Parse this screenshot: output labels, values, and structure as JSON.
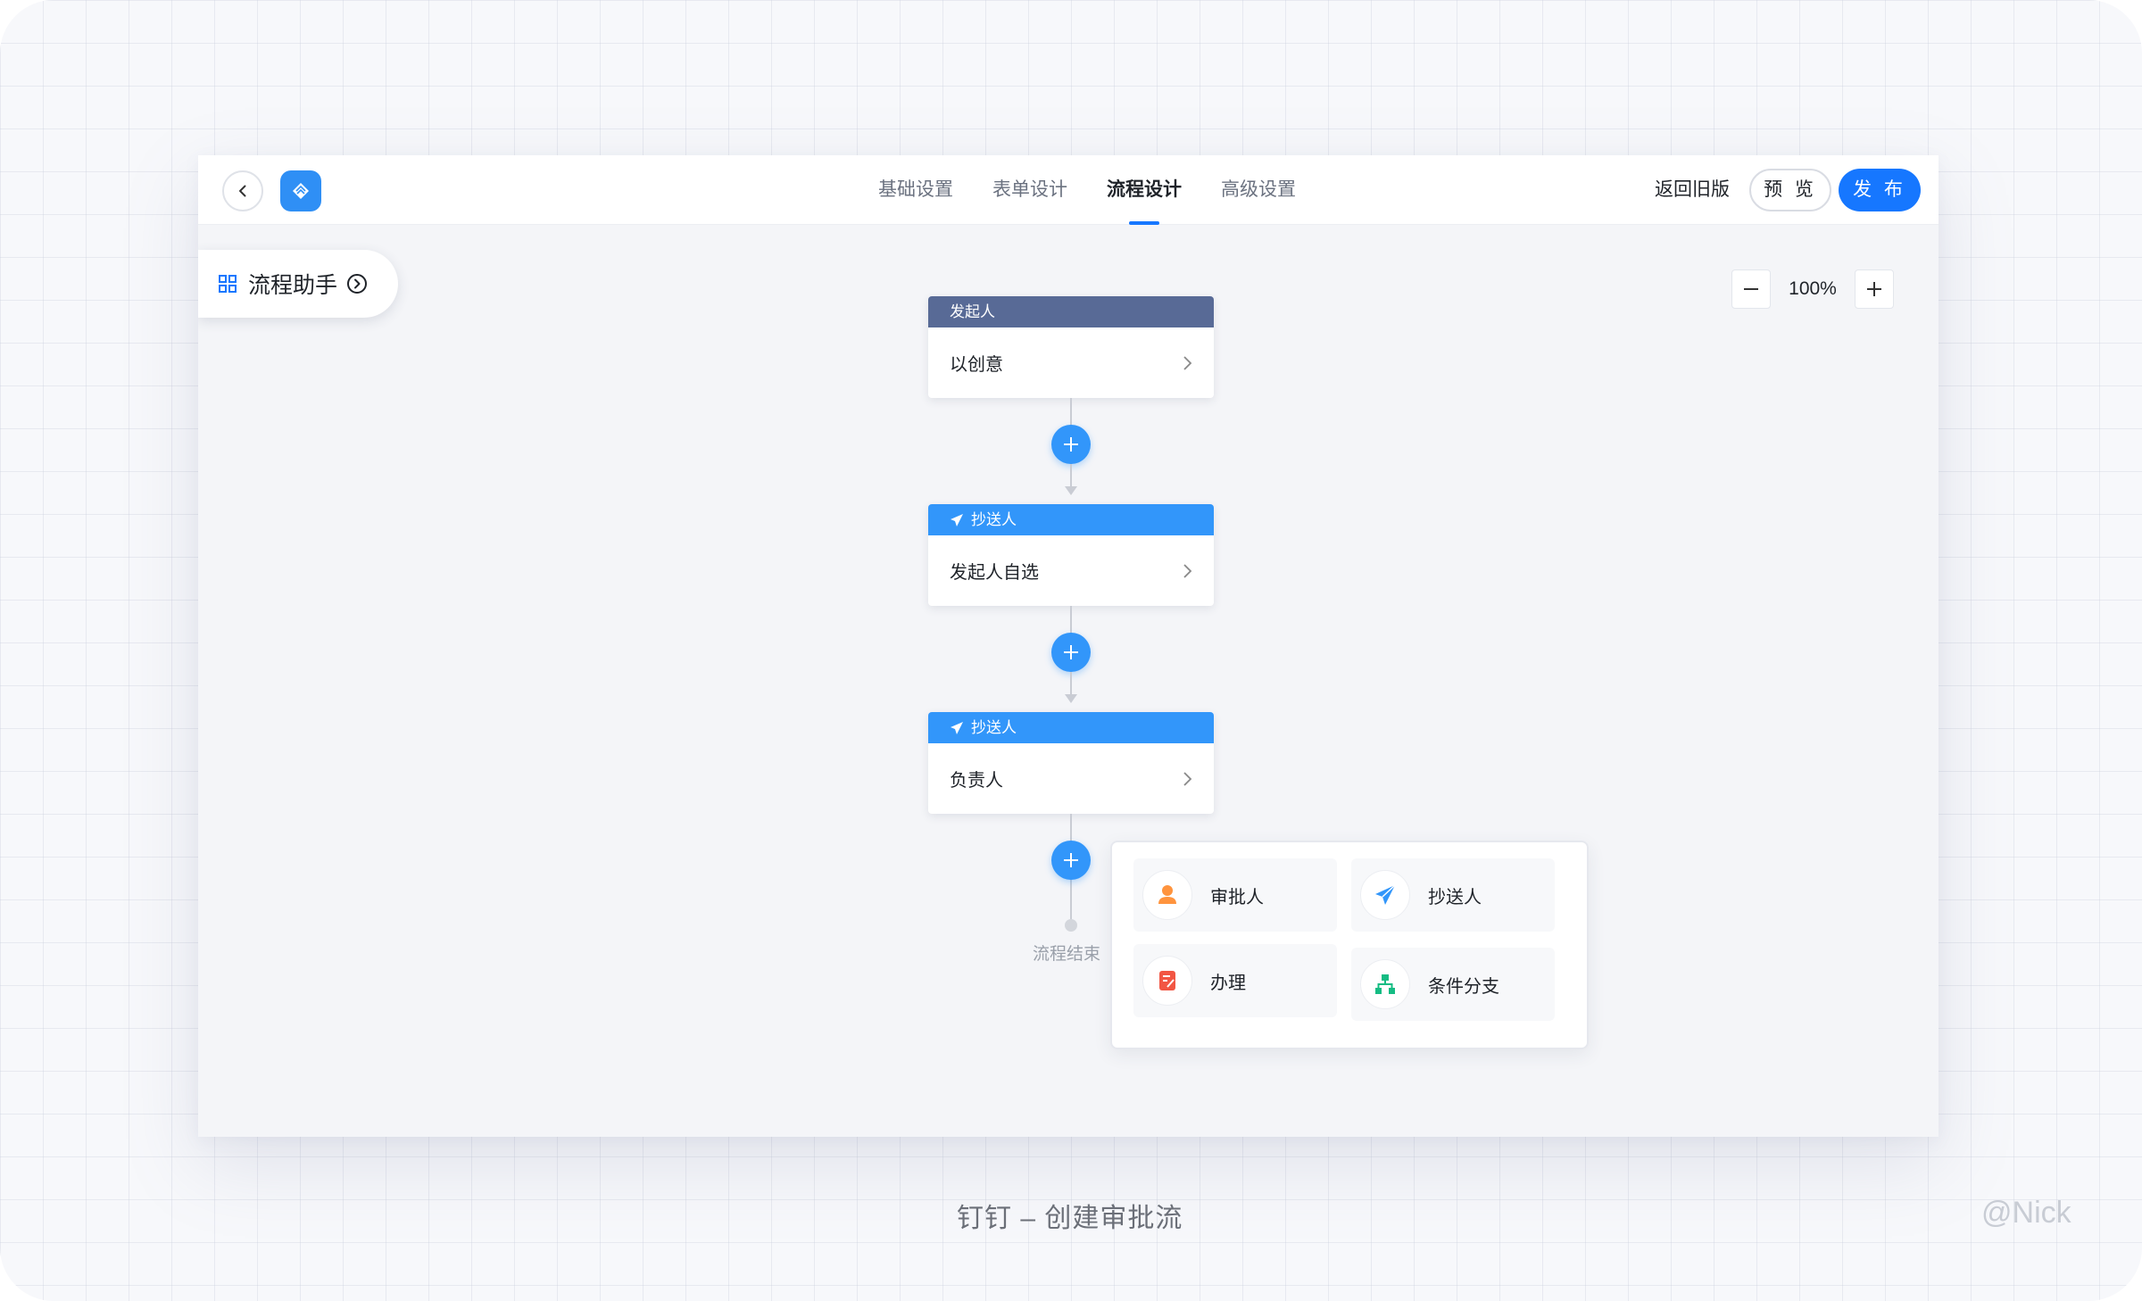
{
  "topbar": {
    "tabs": [
      "基础设置",
      "表单设计",
      "流程设计",
      "高级设置"
    ],
    "active_tab": "流程设计",
    "revert_label": "返回旧版",
    "preview_label": "预 览",
    "publish_label": "发 布"
  },
  "assistant": {
    "label": "流程助手"
  },
  "zoom": {
    "level": "100%"
  },
  "flow": {
    "nodes": [
      {
        "header": "发起人",
        "body": "以创意",
        "icon": "none"
      },
      {
        "header": "抄送人",
        "body": "发起人自选",
        "icon": "paper-plane-icon"
      },
      {
        "header": "抄送人",
        "body": "负责人",
        "icon": "paper-plane-icon"
      }
    ],
    "end_label": "流程结束"
  },
  "add_menu": {
    "items": [
      {
        "label": "审批人",
        "icon": "person-icon",
        "color": "#ff943e"
      },
      {
        "label": "抄送人",
        "icon": "paper-plane-icon",
        "color": "#3296fa"
      },
      {
        "label": "办理",
        "icon": "edit-document-icon",
        "color": "#f25643"
      },
      {
        "label": "条件分支",
        "icon": "branch-icon",
        "color": "#15bc83"
      }
    ]
  },
  "caption": "钉钉 – 创建审批流",
  "watermark": "@Nick",
  "colors": {
    "primary": "#1677ff",
    "node_blue": "#3296fa",
    "node_gray": "#586a96"
  }
}
